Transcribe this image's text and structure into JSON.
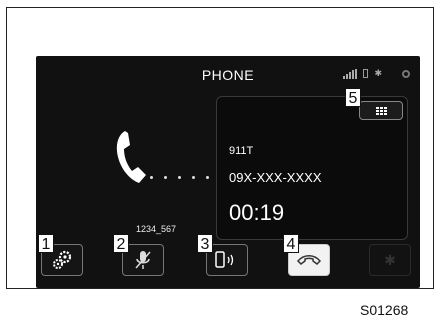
{
  "screen": {
    "title": "PHONE",
    "contact_name": "911T",
    "contact_number": "09X-XXX-XXXX",
    "call_timer": "00:19",
    "device_name": "1234_567",
    "status_icons": [
      "signal-strength-icon",
      "battery-icon",
      "bluetooth-icon",
      "record-icon"
    ]
  },
  "buttons": [
    {
      "name": "settings-button",
      "icon": "gears-icon"
    },
    {
      "name": "mute-button",
      "icon": "microphone-off-icon"
    },
    {
      "name": "handset-mode-button",
      "icon": "handset-speaker-icon"
    },
    {
      "name": "end-call-button",
      "icon": "hang-up-icon"
    },
    {
      "name": "bluetooth-button",
      "icon": "bluetooth-icon",
      "enabled": false
    },
    {
      "name": "keypad-button",
      "icon": "keypad-icon"
    }
  ],
  "callouts": [
    "1",
    "2",
    "3",
    "4",
    "5"
  ],
  "figure_id": "S01268",
  "colors": {
    "screen_bg": "#111111",
    "end_call_bg": "#f2f2f2",
    "text": "#ffffff"
  }
}
